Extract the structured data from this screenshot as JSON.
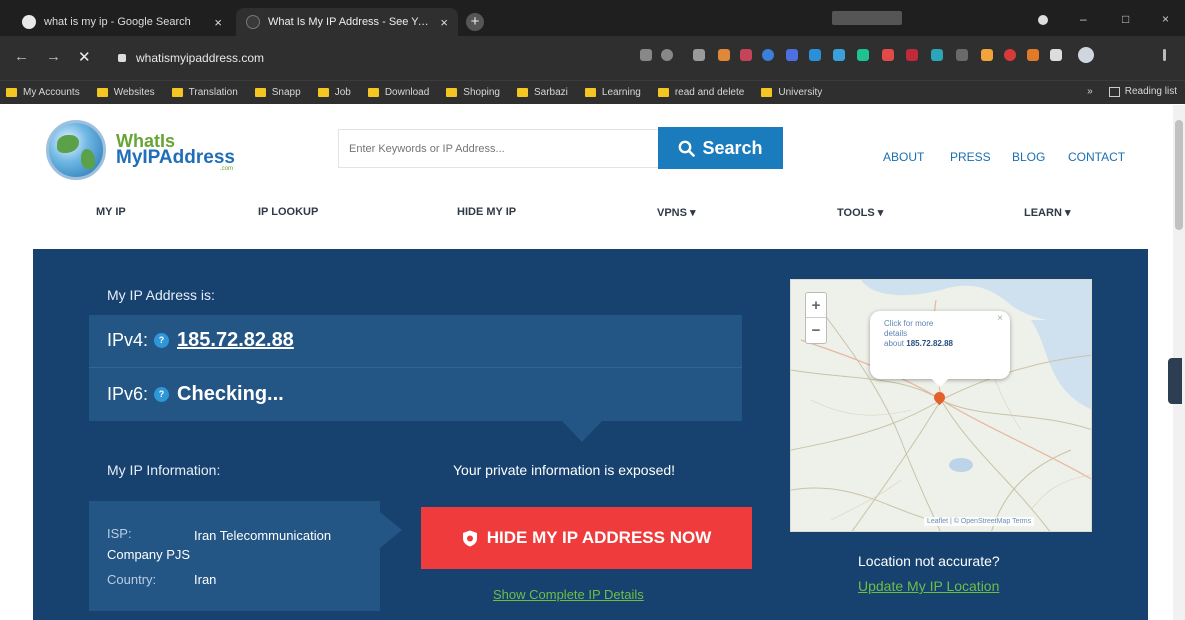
{
  "browser": {
    "tabs": [
      {
        "title": "what is my ip - Google Search",
        "close": "×"
      },
      {
        "title": "What Is My IP Address - See Your...",
        "close": "×"
      }
    ],
    "new_tab": "+",
    "window_controls": {
      "minimize": "–",
      "maximize": "□",
      "close": "×"
    },
    "address": "whatismyipaddress.com",
    "nav": {
      "back": "←",
      "forward": "→",
      "stop": "✕"
    },
    "bookmarks": [
      "My Accounts",
      "Websites",
      "Translation",
      "Snapp",
      "Job",
      "Download",
      "Shoping",
      "Sarbazi",
      "Learning",
      "read and delete",
      "University"
    ],
    "bookmarks_overflow": "»",
    "reading_list": "Reading list",
    "folder_color": "#f3c623"
  },
  "site": {
    "logo": {
      "line1": "WhatIs",
      "line2": "MyIPAddress",
      "suffix": ".com"
    },
    "search": {
      "placeholder": "Enter Keywords or IP Address...",
      "button": "Search"
    },
    "top_links": [
      "ABOUT",
      "PRESS",
      "BLOG",
      "CONTACT"
    ],
    "nav": [
      "MY IP",
      "IP LOOKUP",
      "HIDE MY IP",
      "VPNS ▾",
      "TOOLS ▾",
      "LEARN ▾"
    ],
    "colors": {
      "hero": "#17426f",
      "panel": "#235585",
      "accent_blue": "#1a7bbd",
      "red": "#ef3b3b",
      "green_link": "#6cbf46"
    }
  },
  "hero": {
    "ip_label": "My IP Address is:",
    "ipv4": {
      "label": "IPv4:",
      "help": "?",
      "value": "185.72.82.88"
    },
    "ipv6": {
      "label": "IPv6:",
      "help": "?",
      "value": "Checking..."
    },
    "info_label": "My IP Information:",
    "exposed": "Your private information is exposed!",
    "isp": {
      "label": "ISP:",
      "value": "Iran Telecommunication Company PJS"
    },
    "country": {
      "label": "Country:",
      "value": "Iran"
    },
    "hide_button": "HIDE MY IP ADDRESS NOW",
    "show_details": "Show Complete IP Details",
    "location_question": "Location not accurate?",
    "location_link": "Update My IP Location"
  },
  "map": {
    "zoom_in": "+",
    "zoom_out": "−",
    "popup_line1": "Click for more",
    "popup_line2": "details",
    "popup_about": "about",
    "popup_ip": "185.72.82.88",
    "popup_close": "×",
    "attribution": "Leaflet | © OpenStreetMap Terms"
  }
}
